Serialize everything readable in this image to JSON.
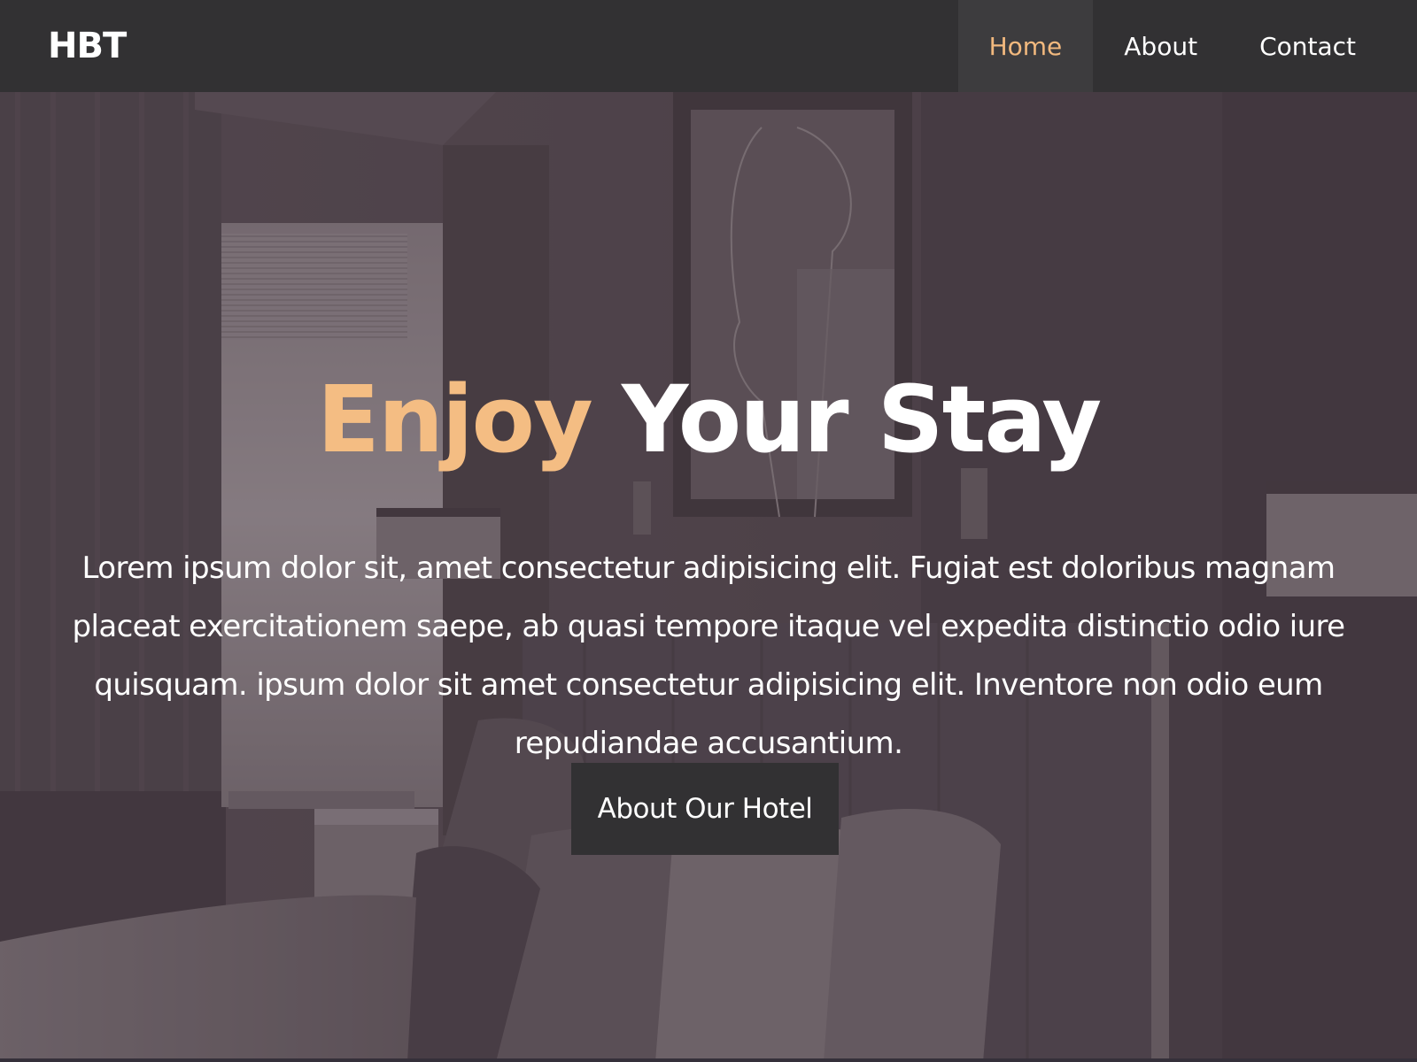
{
  "navbar": {
    "logo": "HBT",
    "links": [
      {
        "label": "Home",
        "active": true
      },
      {
        "label": "About",
        "active": false
      },
      {
        "label": "Contact",
        "active": false
      }
    ]
  },
  "hero": {
    "title_accent": "Enjoy",
    "title_rest": "Your Stay",
    "description": "Lorem ipsum dolor sit, amet consectetur adipisicing elit. Fugiat est doloribus magnam placeat exercitationem saepe, ab quasi tempore itaque vel expedita distinctio odio iure quisquam. ipsum dolor sit amet consectetur adipisicing elit. Inventore non odio eum repudiandae accusantium.",
    "button_label": "About Our Hotel"
  },
  "colors": {
    "navbar_bg": "#323133",
    "accent": "#f4bd83",
    "button_bg": "#323133",
    "overlay": "#4b4249"
  }
}
